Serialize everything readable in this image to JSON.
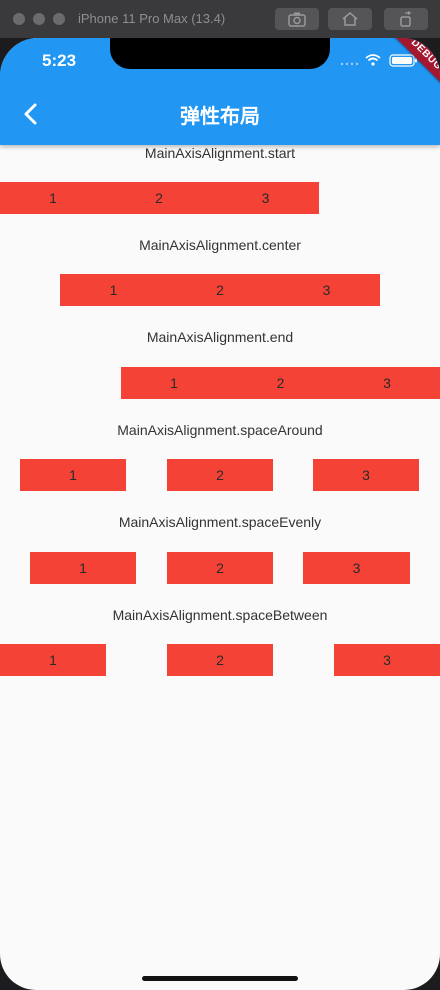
{
  "simulator": {
    "title": "iPhone 11 Pro Max (13.4)"
  },
  "status_bar": {
    "time": "5:23",
    "debug_banner": "DEBUG"
  },
  "app_bar": {
    "title": "弹性布局"
  },
  "sections": [
    {
      "label": "MainAxisAlignment.start",
      "items": [
        "1",
        "2",
        "3"
      ]
    },
    {
      "label": "MainAxisAlignment.center",
      "items": [
        "1",
        "2",
        "3"
      ]
    },
    {
      "label": "MainAxisAlignment.end",
      "items": [
        "1",
        "2",
        "3"
      ]
    },
    {
      "label": "MainAxisAlignment.spaceAround",
      "items": [
        "1",
        "2",
        "3"
      ]
    },
    {
      "label": "MainAxisAlignment.spaceEvenly",
      "items": [
        "1",
        "2",
        "3"
      ]
    },
    {
      "label": "MainAxisAlignment.spaceBetween",
      "items": [
        "1",
        "2",
        "3"
      ]
    }
  ],
  "colors": {
    "primary": "#2196f3",
    "box": "#f44336",
    "debug": "#a5172e"
  }
}
